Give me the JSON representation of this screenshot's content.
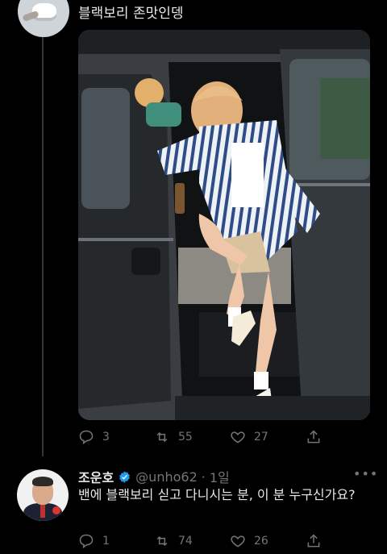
{
  "tweet": {
    "text": "블랙보리 존맛인뎅",
    "stats": {
      "replies": "3",
      "retweets": "55",
      "likes": "27"
    }
  },
  "reply": {
    "name": "조운호",
    "handle": "@unho62",
    "separator": "·",
    "time": "1일",
    "text": "밴에 블랙보리 싣고 다니시는 분, 이 분 누구신가요?",
    "stats": {
      "replies": "1",
      "retweets": "74",
      "likes": "26"
    }
  },
  "colors": {
    "background": "#000000",
    "text": "#e7e9ea",
    "muted": "#71767b",
    "verified": "#1d9bf0"
  },
  "icons": [
    "reply-icon",
    "retweet-icon",
    "like-icon",
    "share-icon",
    "verified-icon",
    "more-icon"
  ]
}
